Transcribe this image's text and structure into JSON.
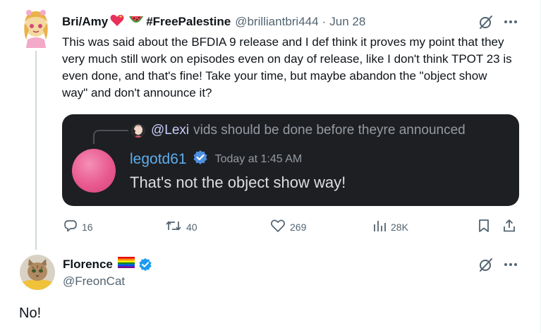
{
  "tweet1": {
    "display_name": "Bri/Amy",
    "name_suffix": "#FreePalestine",
    "handle": "@brilliantbri444",
    "separator": "·",
    "date": "Jun 28",
    "text": "This was said about the BFDIA 9 release and I def think it proves my point that they very much still work on episodes even on day of release, like I don't think TPOT 23 is even done, and that's fine! Take your time, but maybe abandon the \"object show way\" and don't announce it?",
    "embed": {
      "reply_mention": "@Lexi",
      "reply_text": "vids should be done before theyre announced",
      "username": "legotd61",
      "timestamp": "Today at 1:45 AM",
      "message": "That's not the object show way!"
    },
    "actions": {
      "replies": "16",
      "reposts": "40",
      "likes": "269",
      "views": "28K"
    }
  },
  "tweet2": {
    "display_name": "Florence",
    "handle": "@FreonCat",
    "text": "No!"
  },
  "icons": {
    "grok": "grok-icon",
    "more": "more-icon",
    "reply": "reply-icon",
    "repost": "repost-icon",
    "like": "like-icon",
    "views": "views-icon",
    "bookmark": "bookmark-icon",
    "share": "share-icon",
    "verified": "verified-badge-icon",
    "heart_emoji": "sparkling-heart-emoji",
    "watermelon_emoji": "watermelon-emoji",
    "rainbow_flag_emoji": "rainbow-flag-emoji"
  },
  "colors": {
    "text_primary": "#0f1419",
    "text_secondary": "#536471",
    "verified_blue": "#1d9bf0",
    "discord_bg": "#1e1f22",
    "discord_username": "#5dadec",
    "discord_message": "#dbdee1",
    "discord_muted": "#949ba4",
    "discord_mention": "#c9cdfb"
  }
}
